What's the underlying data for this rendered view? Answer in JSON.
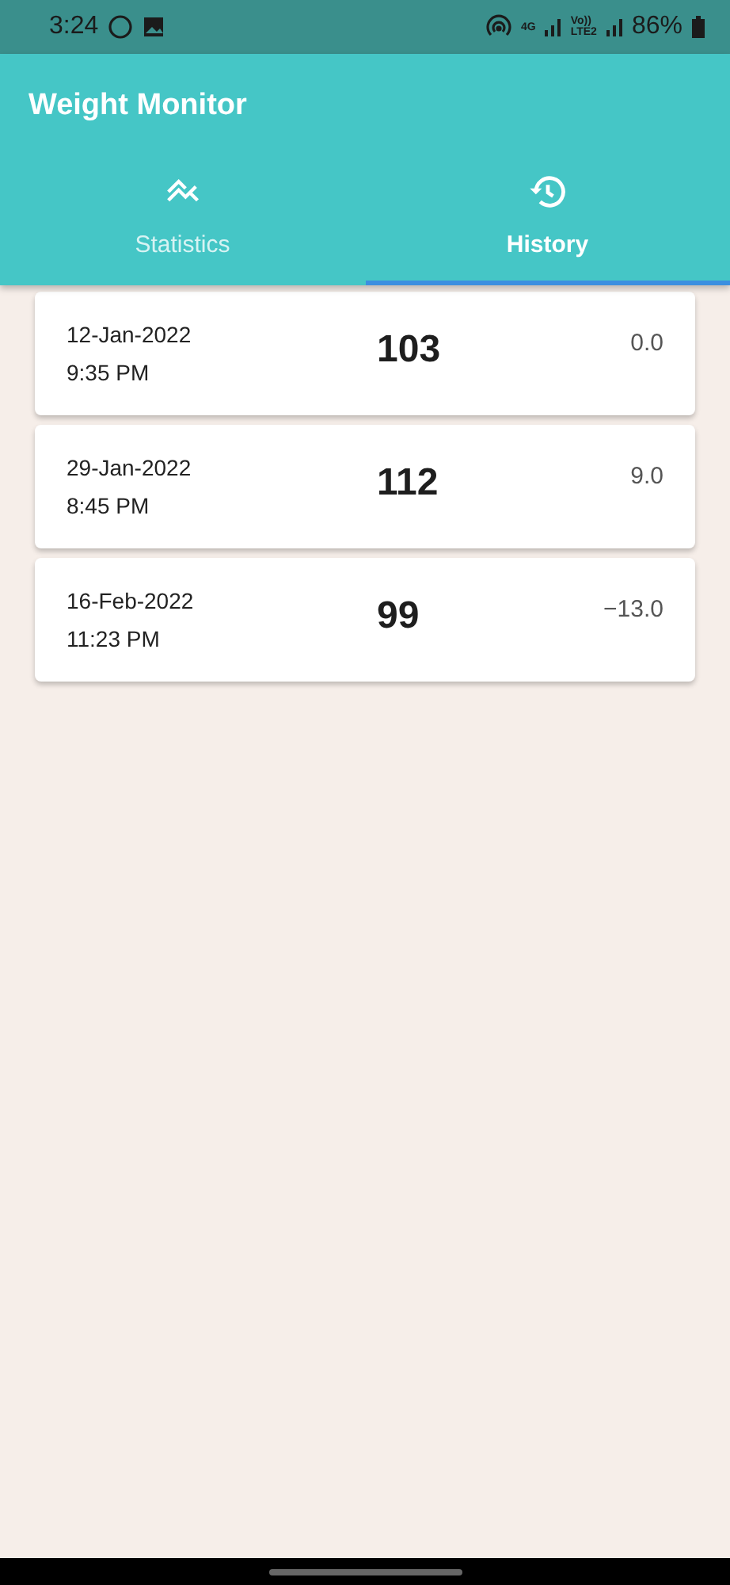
{
  "status_bar": {
    "time": "3:24",
    "network_type": "4G",
    "volte_top": "Vo))",
    "volte_bottom": "LTE2",
    "battery": "86%"
  },
  "app_bar": {
    "title": "Weight Monitor"
  },
  "tabs": [
    {
      "label": "Statistics",
      "kind": "chart",
      "selected": false
    },
    {
      "label": "History",
      "kind": "history",
      "selected": true
    }
  ],
  "entries": [
    {
      "date": "12-Jan-2022",
      "time": "9:35 PM",
      "weight": "103",
      "change": "0.0"
    },
    {
      "date": "29-Jan-2022",
      "time": "8:45 PM",
      "weight": "112",
      "change": "9.0"
    },
    {
      "date": "16-Feb-2022",
      "time": "11:23 PM",
      "weight": "99",
      "change": "−13.0"
    }
  ]
}
